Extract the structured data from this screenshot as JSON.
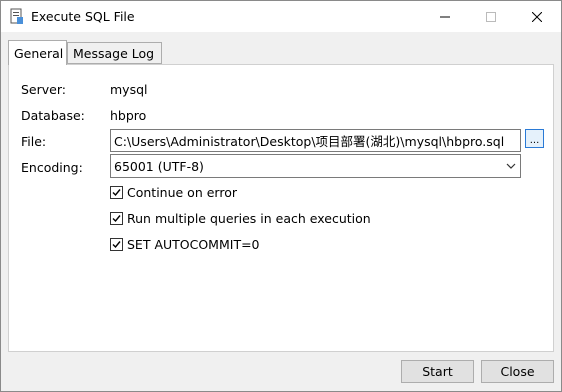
{
  "window": {
    "title": "Execute SQL File"
  },
  "tabs": [
    {
      "label": "General"
    },
    {
      "label": "Message Log"
    }
  ],
  "general": {
    "server_label": "Server:",
    "server_value": "mysql",
    "database_label": "Database:",
    "database_value": "hbpro",
    "file_label": "File:",
    "file_value": "C:\\Users\\Administrator\\Desktop\\项目部署(湖北)\\mysql\\hbpro.sql",
    "browse_label": "...",
    "encoding_label": "Encoding:",
    "encoding_value": "65001 (UTF-8)",
    "options": [
      {
        "label": "Continue on error",
        "checked": true
      },
      {
        "label": "Run multiple queries in each execution",
        "checked": true
      },
      {
        "label": "SET AUTOCOMMIT=0",
        "checked": true
      }
    ]
  },
  "buttons": {
    "start": "Start",
    "close": "Close"
  },
  "colors": {
    "accent": "#2a7ad6"
  }
}
